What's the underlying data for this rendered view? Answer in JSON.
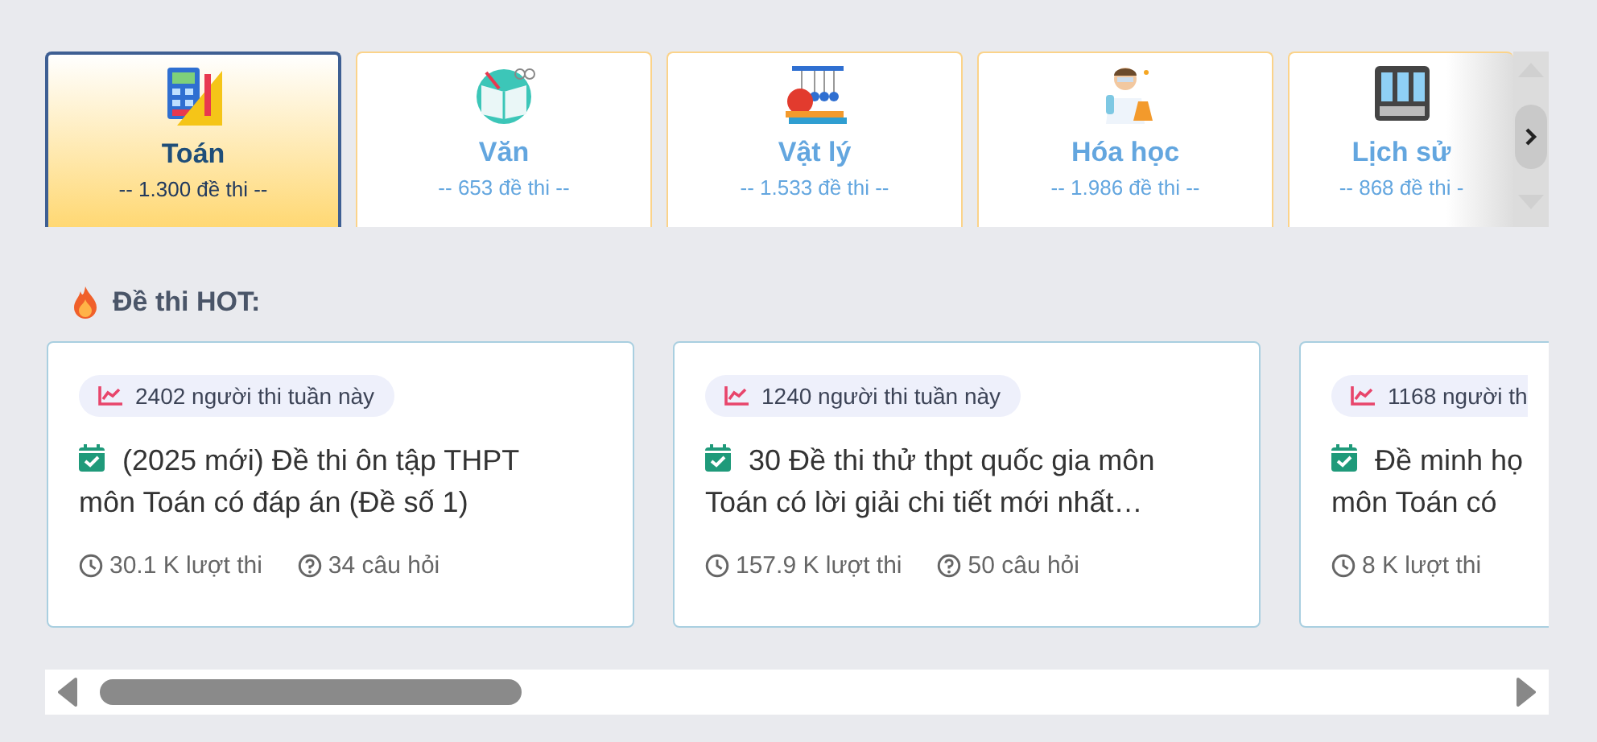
{
  "subjects": [
    {
      "name": "Toán",
      "count": "-- 1.300 đề thi --",
      "selected": true,
      "kind": "calculator"
    },
    {
      "name": "Văn",
      "count": "-- 653 đề thi --",
      "selected": false,
      "kind": "book"
    },
    {
      "name": "Vật lý",
      "count": "-- 1.533 đề thi --",
      "selected": false,
      "kind": "pendulum"
    },
    {
      "name": "Hóa học",
      "count": "-- 1.986 đề thi --",
      "selected": false,
      "kind": "chemist"
    },
    {
      "name": "Lịch sử",
      "count": "-- 868 đề thi -",
      "selected": false,
      "kind": "history"
    }
  ],
  "section_title": "Đề thi HOT:",
  "exams": [
    {
      "badge": "2402 người thi tuần này",
      "title_lines": [
        "(2025 mới) Đề thi ôn tập THPT",
        "môn Toán có đáp án (Đề số 1)"
      ],
      "attempts": "30.1 K lượt thi",
      "questions": "34 câu hỏi"
    },
    {
      "badge": "1240 người thi tuần này",
      "title_lines": [
        "30 Đề thi thử thpt quốc gia môn",
        "Toán có lời giải chi tiết mới nhất…"
      ],
      "attempts": "157.9 K lượt thi",
      "questions": "50 câu hỏi"
    },
    {
      "badge": "1168 người th",
      "title_lines": [
        "Đề minh họ",
        "môn Toán có"
      ],
      "attempts": "8 K lượt thi"
    }
  ]
}
